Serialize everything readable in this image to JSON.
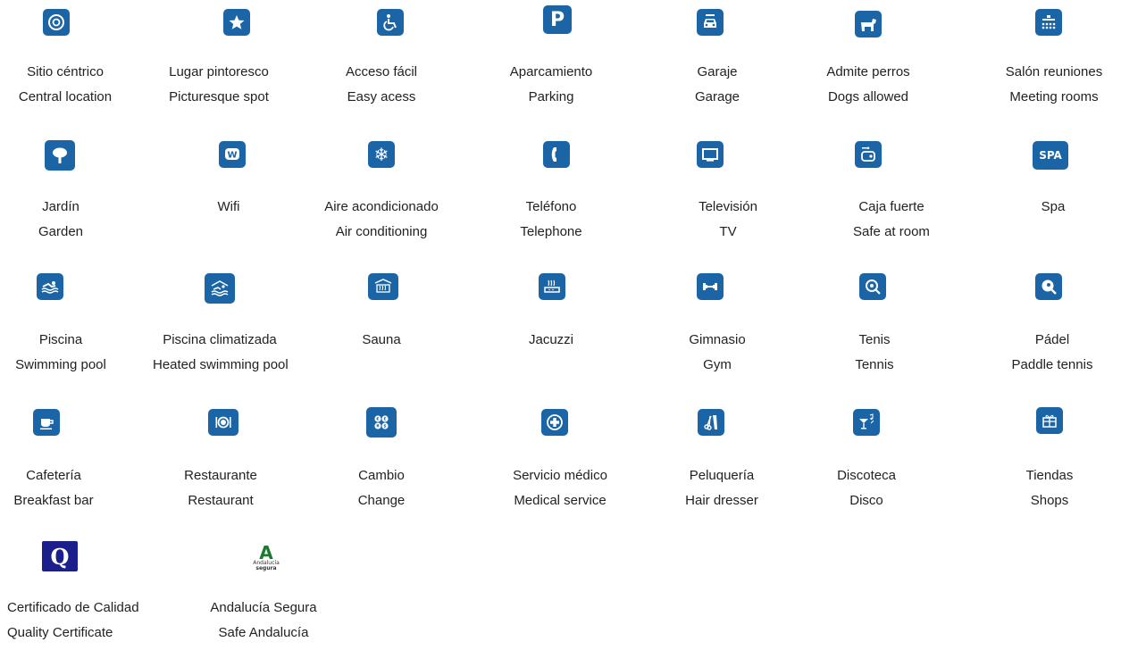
{
  "amenities": [
    {
      "es": "Sitio céntrico",
      "en": "Central location",
      "icon": "central-location-icon"
    },
    {
      "es": "Lugar pintoresco",
      "en": "Picturesque spot",
      "icon": "star-icon"
    },
    {
      "es": "Acceso fácil",
      "en": "Easy acess",
      "icon": "wheelchair-icon"
    },
    {
      "es": "Aparcamiento",
      "en": "Parking",
      "icon": "parking-icon"
    },
    {
      "es": "Garaje",
      "en": "Garage",
      "icon": "garage-car-icon"
    },
    {
      "es": "Admite perros",
      "en": "Dogs allowed",
      "icon": "dog-icon"
    },
    {
      "es": "Salón reuniones",
      "en": "Meeting rooms",
      "icon": "meeting-room-icon"
    },
    {
      "es": "Jardín",
      "en": "Garden",
      "icon": "tree-icon"
    },
    {
      "es": "Wifi",
      "en": "",
      "icon": "wifi-icon"
    },
    {
      "es": "Aire acondicionado",
      "en": "Air conditioning",
      "icon": "snowflake-icon"
    },
    {
      "es": "Teléfono",
      "en": "Telephone",
      "icon": "phone-icon"
    },
    {
      "es": "Televisión",
      "en": "TV",
      "icon": "tv-icon"
    },
    {
      "es": "Caja fuerte",
      "en": "Safe at room",
      "icon": "safe-icon"
    },
    {
      "es": "Spa",
      "en": "",
      "icon": "spa-icon"
    },
    {
      "es": "Piscina",
      "en": "Swimming pool",
      "icon": "swimming-pool-icon"
    },
    {
      "es": "Piscina climatizada",
      "en": "Heated swimming pool",
      "icon": "heated-pool-icon"
    },
    {
      "es": "Sauna",
      "en": "",
      "icon": "sauna-icon"
    },
    {
      "es": "Jacuzzi",
      "en": "",
      "icon": "jacuzzi-icon"
    },
    {
      "es": "Gimnasio",
      "en": "Gym",
      "icon": "dumbbell-icon"
    },
    {
      "es": "Tenis",
      "en": "Tennis",
      "icon": "tennis-racket-icon"
    },
    {
      "es": "Pádel",
      "en": "Paddle tennis",
      "icon": "paddle-racket-icon"
    },
    {
      "es": "Cafetería",
      "en": "Breakfast bar",
      "icon": "coffee-cup-icon"
    },
    {
      "es": "Restaurante",
      "en": "Restaurant",
      "icon": "plate-cutlery-icon"
    },
    {
      "es": "Cambio",
      "en": "Change",
      "icon": "currency-exchange-icon"
    },
    {
      "es": "Servicio médico",
      "en": "Medical service",
      "icon": "medical-cross-icon"
    },
    {
      "es": "Peluquería",
      "en": "Hair dresser",
      "icon": "scissors-comb-icon"
    },
    {
      "es": "Discoteca",
      "en": "Disco",
      "icon": "cocktail-icon"
    },
    {
      "es": "Tiendas",
      "en": "Shops",
      "icon": "gift-icon"
    }
  ],
  "certificates": [
    {
      "es": "Certificado de Calidad",
      "en": "Quality Certificate",
      "icon": "quality-q-logo",
      "logo_text": "Q"
    },
    {
      "es": "Andalucía Segura",
      "en": "Safe Andalucía",
      "icon": "andalucia-segura-logo",
      "logo_text": "A",
      "logo_line1": "Andalucía",
      "logo_line2": "segura"
    }
  ],
  "colors": {
    "icon_blue": "#1b65a6",
    "quality_navy": "#1b1f8c",
    "andalucia_green": "#1a7a2e"
  }
}
